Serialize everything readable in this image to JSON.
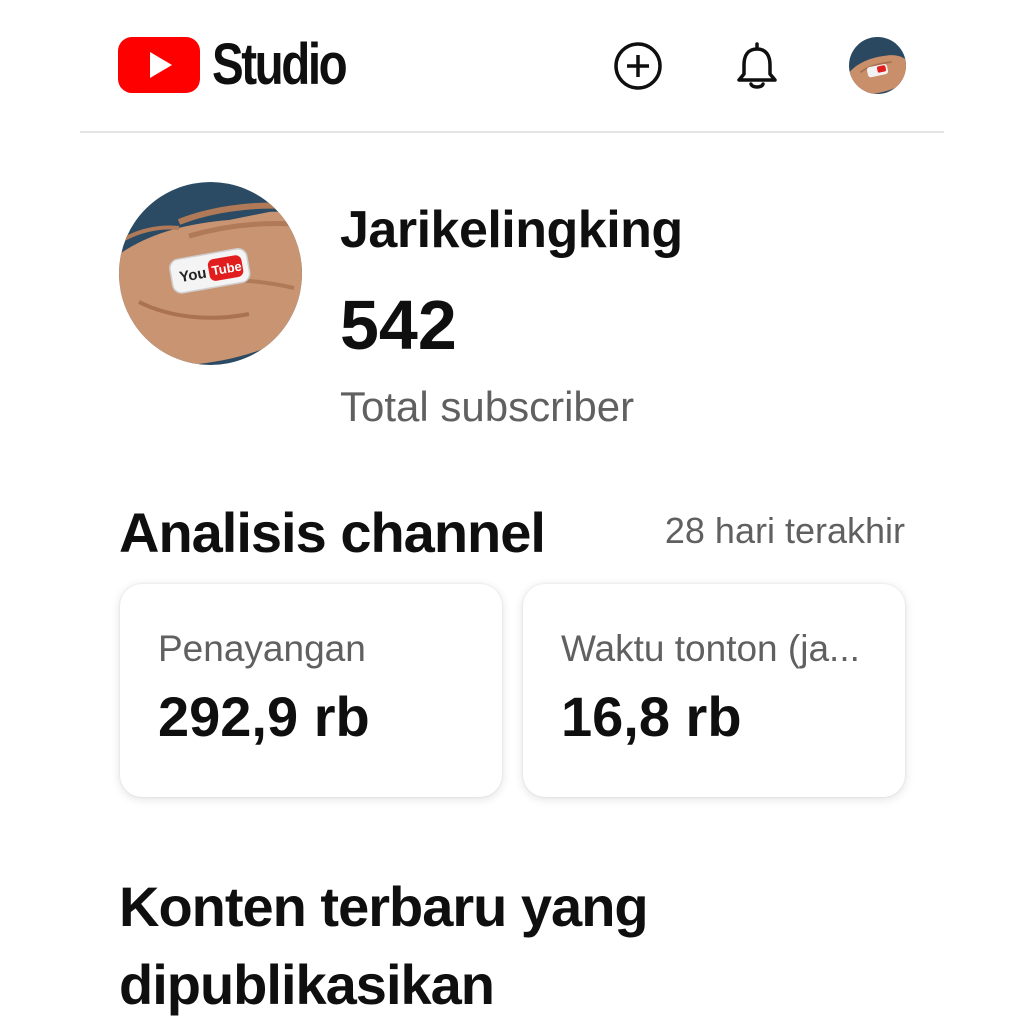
{
  "header": {
    "app_name": "Studio",
    "icons": [
      "youtube-logo-icon",
      "create-icon",
      "bell-icon",
      "avatar"
    ]
  },
  "channel": {
    "name": "Jarikelingking",
    "subscriber_count": "542",
    "subscriber_label": "Total subscriber"
  },
  "analytics": {
    "title": "Analisis channel",
    "period": "28 hari terakhir",
    "cards": [
      {
        "label": "Penayangan",
        "value": "292,9 rb"
      },
      {
        "label": "Waktu tonton (ja...",
        "value": "16,8 rb"
      }
    ]
  },
  "recent": {
    "title": "Konten terbaru yang dipublikasikan"
  },
  "colors": {
    "brand_red": "#ff0000",
    "text_primary": "#0f0f0f",
    "text_secondary": "#606060",
    "divider": "#e5e5e5"
  }
}
